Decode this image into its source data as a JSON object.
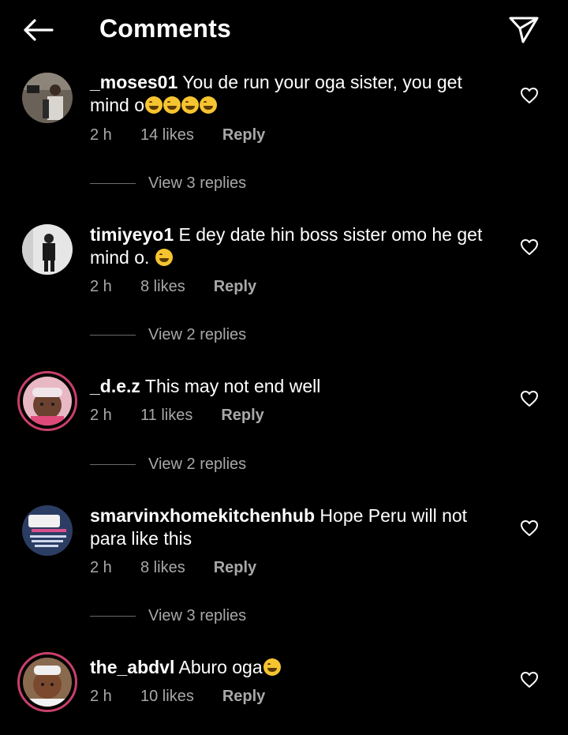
{
  "header": {
    "title": "Comments",
    "back_icon": "back-arrow-icon",
    "send_icon": "send-icon"
  },
  "comments": [
    {
      "username": "_moses01",
      "text": "You de run your oga sister,  you get mind o",
      "emoji_count": 4,
      "time": "2 h",
      "likes": "14 likes",
      "reply": "Reply",
      "view_replies": "View 3 replies"
    },
    {
      "username": "timiyeyo1",
      "text": "E dey date hin boss sister omo he get mind o. ",
      "emoji_count": 1,
      "time": "2 h",
      "likes": "8 likes",
      "reply": "Reply",
      "view_replies": "View 2 replies"
    },
    {
      "username": "_d.e.z",
      "text": "This may not end well",
      "emoji_count": 0,
      "time": "2 h",
      "likes": "11 likes",
      "reply": "Reply",
      "view_replies": "View 2 replies"
    },
    {
      "username": "smarvinxhomekitchenhub",
      "text": "Hope Peru will not para like this",
      "emoji_count": 0,
      "time": "2 h",
      "likes": "8 likes",
      "reply": "Reply",
      "view_replies": "View 3 replies"
    },
    {
      "username": "the_abdvl",
      "text": "Aburo oga",
      "emoji_count": 1,
      "time": "2 h",
      "likes": "10 likes",
      "reply": "Reply"
    }
  ],
  "colors": {
    "background": "#000000",
    "text": "#ffffff",
    "secondary": "#a8a8a8",
    "story_ring": "#c8406a"
  }
}
